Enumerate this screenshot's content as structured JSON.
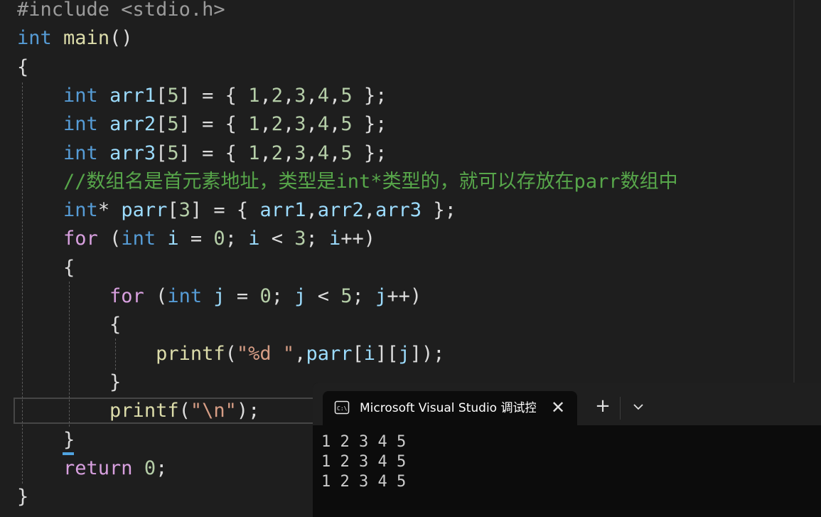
{
  "code": {
    "lines": [
      {
        "segments": [
          {
            "t": "#include <stdio.h>",
            "c": "pp"
          }
        ]
      },
      {
        "segments": [
          {
            "t": "int",
            "c": "kw"
          },
          {
            "t": " "
          },
          {
            "t": "main",
            "c": "fn"
          },
          {
            "t": "()"
          }
        ]
      },
      {
        "segments": [
          {
            "t": "{"
          }
        ]
      },
      {
        "segments": [
          {
            "t": "    "
          },
          {
            "t": "int",
            "c": "kw"
          },
          {
            "t": " "
          },
          {
            "t": "arr1",
            "c": "var"
          },
          {
            "t": "["
          },
          {
            "t": "5",
            "c": "num"
          },
          {
            "t": "] = { "
          },
          {
            "t": "1",
            "c": "num"
          },
          {
            "t": ","
          },
          {
            "t": "2",
            "c": "num"
          },
          {
            "t": ","
          },
          {
            "t": "3",
            "c": "num"
          },
          {
            "t": ","
          },
          {
            "t": "4",
            "c": "num"
          },
          {
            "t": ","
          },
          {
            "t": "5",
            "c": "num"
          },
          {
            "t": " };"
          }
        ]
      },
      {
        "segments": [
          {
            "t": "    "
          },
          {
            "t": "int",
            "c": "kw"
          },
          {
            "t": " "
          },
          {
            "t": "arr2",
            "c": "var"
          },
          {
            "t": "["
          },
          {
            "t": "5",
            "c": "num"
          },
          {
            "t": "] = { "
          },
          {
            "t": "1",
            "c": "num"
          },
          {
            "t": ","
          },
          {
            "t": "2",
            "c": "num"
          },
          {
            "t": ","
          },
          {
            "t": "3",
            "c": "num"
          },
          {
            "t": ","
          },
          {
            "t": "4",
            "c": "num"
          },
          {
            "t": ","
          },
          {
            "t": "5",
            "c": "num"
          },
          {
            "t": " };"
          }
        ]
      },
      {
        "segments": [
          {
            "t": "    "
          },
          {
            "t": "int",
            "c": "kw"
          },
          {
            "t": " "
          },
          {
            "t": "arr3",
            "c": "var"
          },
          {
            "t": "["
          },
          {
            "t": "5",
            "c": "num"
          },
          {
            "t": "] = { "
          },
          {
            "t": "1",
            "c": "num"
          },
          {
            "t": ","
          },
          {
            "t": "2",
            "c": "num"
          },
          {
            "t": ","
          },
          {
            "t": "3",
            "c": "num"
          },
          {
            "t": ","
          },
          {
            "t": "4",
            "c": "num"
          },
          {
            "t": ","
          },
          {
            "t": "5",
            "c": "num"
          },
          {
            "t": " };"
          }
        ]
      },
      {
        "segments": [
          {
            "t": "    "
          },
          {
            "t": "//数组名是首元素地址，类型是int*类型的，就可以存放在parr数组中",
            "c": "cmt"
          }
        ]
      },
      {
        "segments": [
          {
            "t": "    "
          },
          {
            "t": "int",
            "c": "kw"
          },
          {
            "t": "* "
          },
          {
            "t": "parr",
            "c": "var"
          },
          {
            "t": "["
          },
          {
            "t": "3",
            "c": "num"
          },
          {
            "t": "] = { "
          },
          {
            "t": "arr1",
            "c": "var"
          },
          {
            "t": ","
          },
          {
            "t": "arr2",
            "c": "var"
          },
          {
            "t": ","
          },
          {
            "t": "arr3",
            "c": "var"
          },
          {
            "t": " };"
          }
        ]
      },
      {
        "segments": [
          {
            "t": "    "
          },
          {
            "t": "for",
            "c": "ctl"
          },
          {
            "t": " ("
          },
          {
            "t": "int",
            "c": "kw"
          },
          {
            "t": " "
          },
          {
            "t": "i",
            "c": "var"
          },
          {
            "t": " = "
          },
          {
            "t": "0",
            "c": "num"
          },
          {
            "t": "; "
          },
          {
            "t": "i",
            "c": "var"
          },
          {
            "t": " < "
          },
          {
            "t": "3",
            "c": "num"
          },
          {
            "t": "; "
          },
          {
            "t": "i",
            "c": "var"
          },
          {
            "t": "++)"
          }
        ]
      },
      {
        "segments": [
          {
            "t": "    {"
          }
        ]
      },
      {
        "segments": [
          {
            "t": "        "
          },
          {
            "t": "for",
            "c": "ctl"
          },
          {
            "t": " ("
          },
          {
            "t": "int",
            "c": "kw"
          },
          {
            "t": " "
          },
          {
            "t": "j",
            "c": "var"
          },
          {
            "t": " = "
          },
          {
            "t": "0",
            "c": "num"
          },
          {
            "t": "; "
          },
          {
            "t": "j",
            "c": "var"
          },
          {
            "t": " < "
          },
          {
            "t": "5",
            "c": "num"
          },
          {
            "t": "; "
          },
          {
            "t": "j",
            "c": "var"
          },
          {
            "t": "++)"
          }
        ]
      },
      {
        "segments": [
          {
            "t": "        {"
          }
        ]
      },
      {
        "segments": [
          {
            "t": "            "
          },
          {
            "t": "printf",
            "c": "fn"
          },
          {
            "t": "("
          },
          {
            "t": "\"%d \"",
            "c": "str"
          },
          {
            "t": ","
          },
          {
            "t": "parr",
            "c": "var"
          },
          {
            "t": "["
          },
          {
            "t": "i",
            "c": "var"
          },
          {
            "t": "]["
          },
          {
            "t": "j",
            "c": "var"
          },
          {
            "t": "]);"
          }
        ]
      },
      {
        "segments": [
          {
            "t": "        }"
          }
        ]
      },
      {
        "segments": [
          {
            "t": "        "
          },
          {
            "t": "printf",
            "c": "fn"
          },
          {
            "t": "("
          },
          {
            "t": "\"\\n\"",
            "c": "str"
          },
          {
            "t": ");"
          }
        ]
      },
      {
        "segments": [
          {
            "t": "    }"
          }
        ]
      },
      {
        "segments": [
          {
            "t": "    "
          },
          {
            "t": "return",
            "c": "ctl"
          },
          {
            "t": " "
          },
          {
            "t": "0",
            "c": "num"
          },
          {
            "t": ";"
          }
        ]
      },
      {
        "segments": [
          {
            "t": "}"
          }
        ]
      }
    ]
  },
  "terminal": {
    "tab_title": "Microsoft Visual Studio 调试控制台",
    "tab_icon": "console-icon",
    "close_glyph": "✕",
    "new_tab_glyph": "+",
    "output_lines": [
      "1 2 3 4 5",
      "1 2 3 4 5",
      "1 2 3 4 5"
    ]
  },
  "colors": {
    "editor_bg": "#1e1e1e",
    "keyword": "#569cd6",
    "control_keyword": "#d8a0df",
    "function": "#dcdcaa",
    "variable": "#9cdcfe",
    "number": "#b5cea8",
    "string": "#d69d85",
    "comment": "#57a64a",
    "preprocessor": "#9b9b9b",
    "terminal_bg": "#0c0c0c"
  }
}
